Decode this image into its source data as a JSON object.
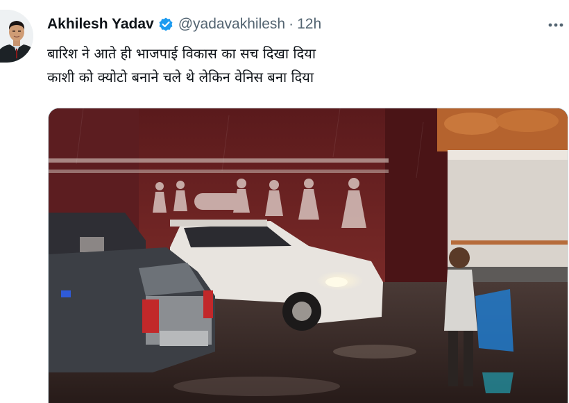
{
  "author": {
    "display_name": "Akhilesh Yadav",
    "verified_icon": "verified-badge-icon",
    "handle": "@yadavakhilesh",
    "separator": "·",
    "timestamp": "12h"
  },
  "menu": {
    "more_icon": "more-options-icon",
    "more_glyph": "•••"
  },
  "tweet": {
    "lines": [
      "बारिश ने आते ही भाजपाई विकास का सच दिखा दिया",
      "काशी को क्योटो बनाने चले थे लेकिन वेनिस बना दिया"
    ]
  },
  "media": {
    "type": "photo",
    "subject": "waterlogged-street-night-cars"
  },
  "colors": {
    "text_primary": "#0f1419",
    "text_secondary": "#536471",
    "verified_blue": "#1d9bf0",
    "border": "#cfd9de"
  }
}
